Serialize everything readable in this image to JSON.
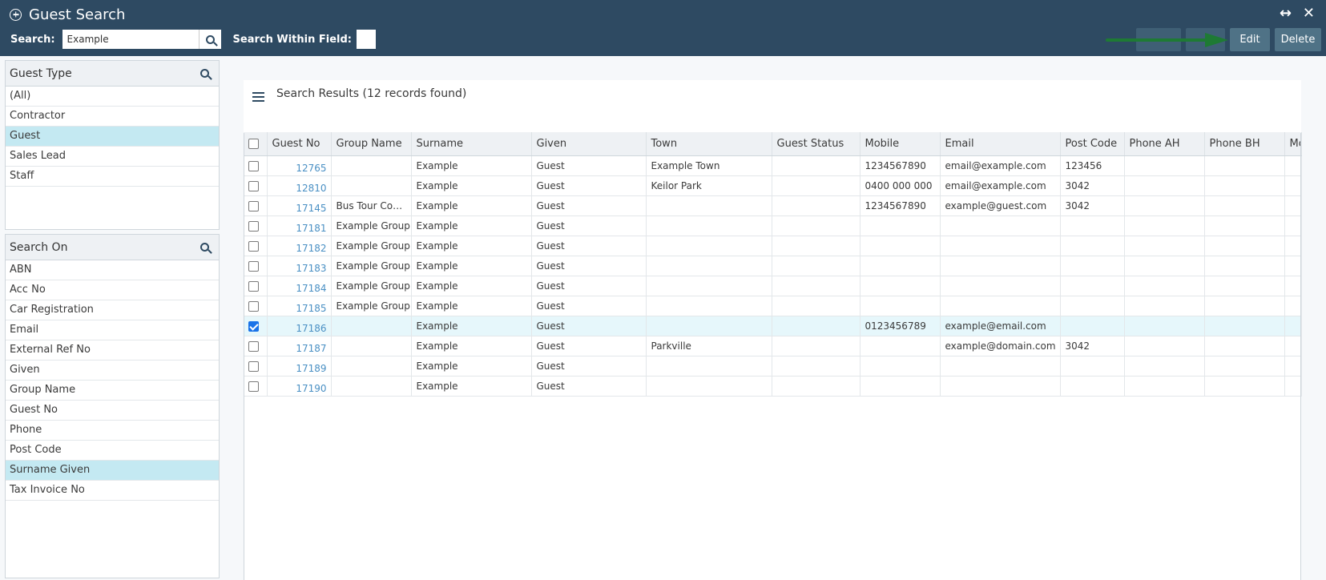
{
  "header": {
    "title": "Guest Search",
    "search_label": "Search:",
    "search_value": "Example",
    "within_label": "Search Within Field:",
    "actions": {
      "blank1": "",
      "blank2": "",
      "edit": "Edit",
      "delete": "Delete"
    },
    "arrow_color": "#1e7a34"
  },
  "guest_type": {
    "title": "Guest Type",
    "items": [
      {
        "label": "(All)",
        "selected": false
      },
      {
        "label": "Contractor",
        "selected": false
      },
      {
        "label": "Guest",
        "selected": true
      },
      {
        "label": "Sales Lead",
        "selected": false
      },
      {
        "label": "Staff",
        "selected": false
      }
    ]
  },
  "search_on": {
    "title": "Search On",
    "items": [
      {
        "label": "ABN",
        "selected": false
      },
      {
        "label": "Acc No",
        "selected": false
      },
      {
        "label": "Car Registration",
        "selected": false
      },
      {
        "label": "Email",
        "selected": false
      },
      {
        "label": "External Ref No",
        "selected": false
      },
      {
        "label": "Given",
        "selected": false
      },
      {
        "label": "Group Name",
        "selected": false
      },
      {
        "label": "Guest No",
        "selected": false
      },
      {
        "label": "Phone",
        "selected": false
      },
      {
        "label": "Post Code",
        "selected": false
      },
      {
        "label": "Surname Given",
        "selected": true
      },
      {
        "label": "Tax Invoice No",
        "selected": false
      }
    ]
  },
  "results": {
    "title": "Search Results (12 records found)",
    "columns": [
      "",
      "Guest No",
      "Group Name",
      "Surname",
      "Given",
      "Town",
      "Guest Status",
      "Mobile",
      "Email",
      "Post Code",
      "Phone AH",
      "Phone BH",
      "Mo"
    ],
    "rows": [
      {
        "checked": false,
        "no": "12765",
        "group": "",
        "surname": "Example",
        "given": "Guest",
        "town": "Example Town",
        "status": "",
        "mobile": "1234567890",
        "email": "email@example.com",
        "post": "123456",
        "ah": "",
        "bh": "",
        "mo": ""
      },
      {
        "checked": false,
        "no": "12810",
        "group": "",
        "surname": "Example",
        "given": "Guest",
        "town": "Keilor Park",
        "status": "",
        "mobile": "0400 000 000",
        "email": "email@example.com",
        "post": "3042",
        "ah": "",
        "bh": "",
        "mo": ""
      },
      {
        "checked": false,
        "no": "17145",
        "group": "Bus Tour Com...",
        "surname": "Example",
        "given": "Guest",
        "town": "",
        "status": "",
        "mobile": "1234567890",
        "email": "example@guest.com",
        "post": "3042",
        "ah": "",
        "bh": "",
        "mo": ""
      },
      {
        "checked": false,
        "no": "17181",
        "group": "Example Group",
        "surname": "Example",
        "given": "Guest",
        "town": "",
        "status": "",
        "mobile": "",
        "email": "",
        "post": "",
        "ah": "",
        "bh": "",
        "mo": ""
      },
      {
        "checked": false,
        "no": "17182",
        "group": "Example Group",
        "surname": "Example",
        "given": "Guest",
        "town": "",
        "status": "",
        "mobile": "",
        "email": "",
        "post": "",
        "ah": "",
        "bh": "",
        "mo": ""
      },
      {
        "checked": false,
        "no": "17183",
        "group": "Example Group",
        "surname": "Example",
        "given": "Guest",
        "town": "",
        "status": "",
        "mobile": "",
        "email": "",
        "post": "",
        "ah": "",
        "bh": "",
        "mo": ""
      },
      {
        "checked": false,
        "no": "17184",
        "group": "Example Group",
        "surname": "Example",
        "given": "Guest",
        "town": "",
        "status": "",
        "mobile": "",
        "email": "",
        "post": "",
        "ah": "",
        "bh": "",
        "mo": ""
      },
      {
        "checked": false,
        "no": "17185",
        "group": "Example Group",
        "surname": "Example",
        "given": "Guest",
        "town": "",
        "status": "",
        "mobile": "",
        "email": "",
        "post": "",
        "ah": "",
        "bh": "",
        "mo": ""
      },
      {
        "checked": true,
        "no": "17186",
        "group": "",
        "surname": "Example",
        "given": "Guest",
        "town": "",
        "status": "",
        "mobile": "0123456789",
        "email": "example@email.com",
        "post": "",
        "ah": "",
        "bh": "",
        "mo": ""
      },
      {
        "checked": false,
        "no": "17187",
        "group": "",
        "surname": "Example",
        "given": "Guest",
        "town": "Parkville",
        "status": "",
        "mobile": "",
        "email": "example@domain.com",
        "post": "3042",
        "ah": "",
        "bh": "",
        "mo": ""
      },
      {
        "checked": false,
        "no": "17189",
        "group": "",
        "surname": "Example",
        "given": "Guest",
        "town": "",
        "status": "",
        "mobile": "",
        "email": "",
        "post": "",
        "ah": "",
        "bh": "",
        "mo": ""
      },
      {
        "checked": false,
        "no": "17190",
        "group": "",
        "surname": "Example",
        "given": "Guest",
        "town": "",
        "status": "",
        "mobile": "",
        "email": "",
        "post": "",
        "ah": "",
        "bh": "",
        "mo": ""
      }
    ]
  }
}
